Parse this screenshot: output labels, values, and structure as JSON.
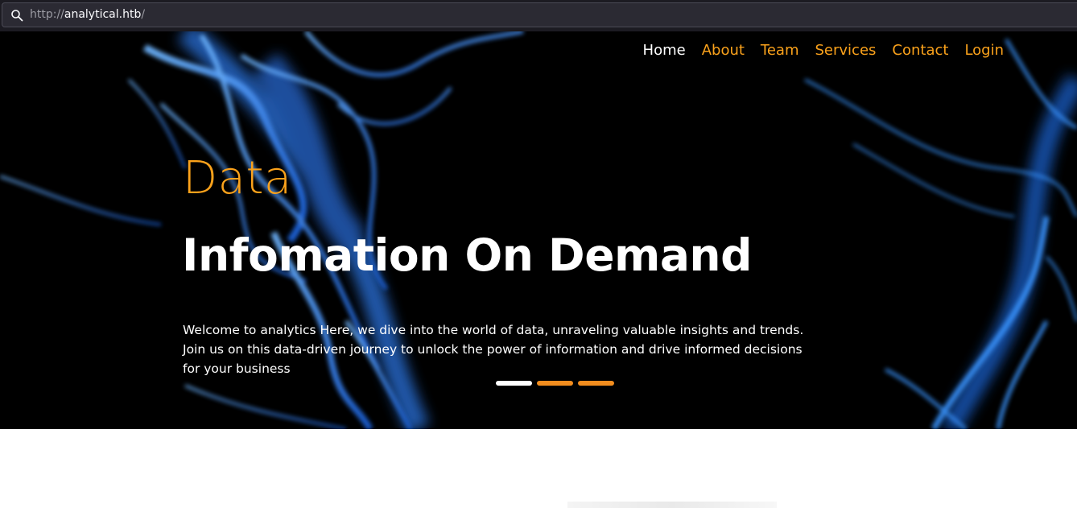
{
  "browser": {
    "url_scheme": "http://",
    "url_host": "analytical.htb",
    "url_trailing": "/"
  },
  "nav": {
    "items": [
      {
        "label": "Home",
        "active": true
      },
      {
        "label": "About",
        "active": false
      },
      {
        "label": "Team",
        "active": false
      },
      {
        "label": "Services",
        "active": false
      },
      {
        "label": "Contact",
        "active": false
      },
      {
        "label": "Login",
        "active": false
      }
    ]
  },
  "hero": {
    "subtitle": "Data",
    "title": "Infomation On Demand",
    "text": "Welcome to analytics Here, we dive into the world of data, unraveling valuable insights and trends. Join us on this data-driven journey to unlock the power of information and drive informed decisions for your business",
    "slides": 3,
    "active_slide": 1
  },
  "colors": {
    "accent": "#fba21b",
    "indicator": "#f28d1e",
    "hero_background": "#000000",
    "smoke": "#3a8cff"
  }
}
